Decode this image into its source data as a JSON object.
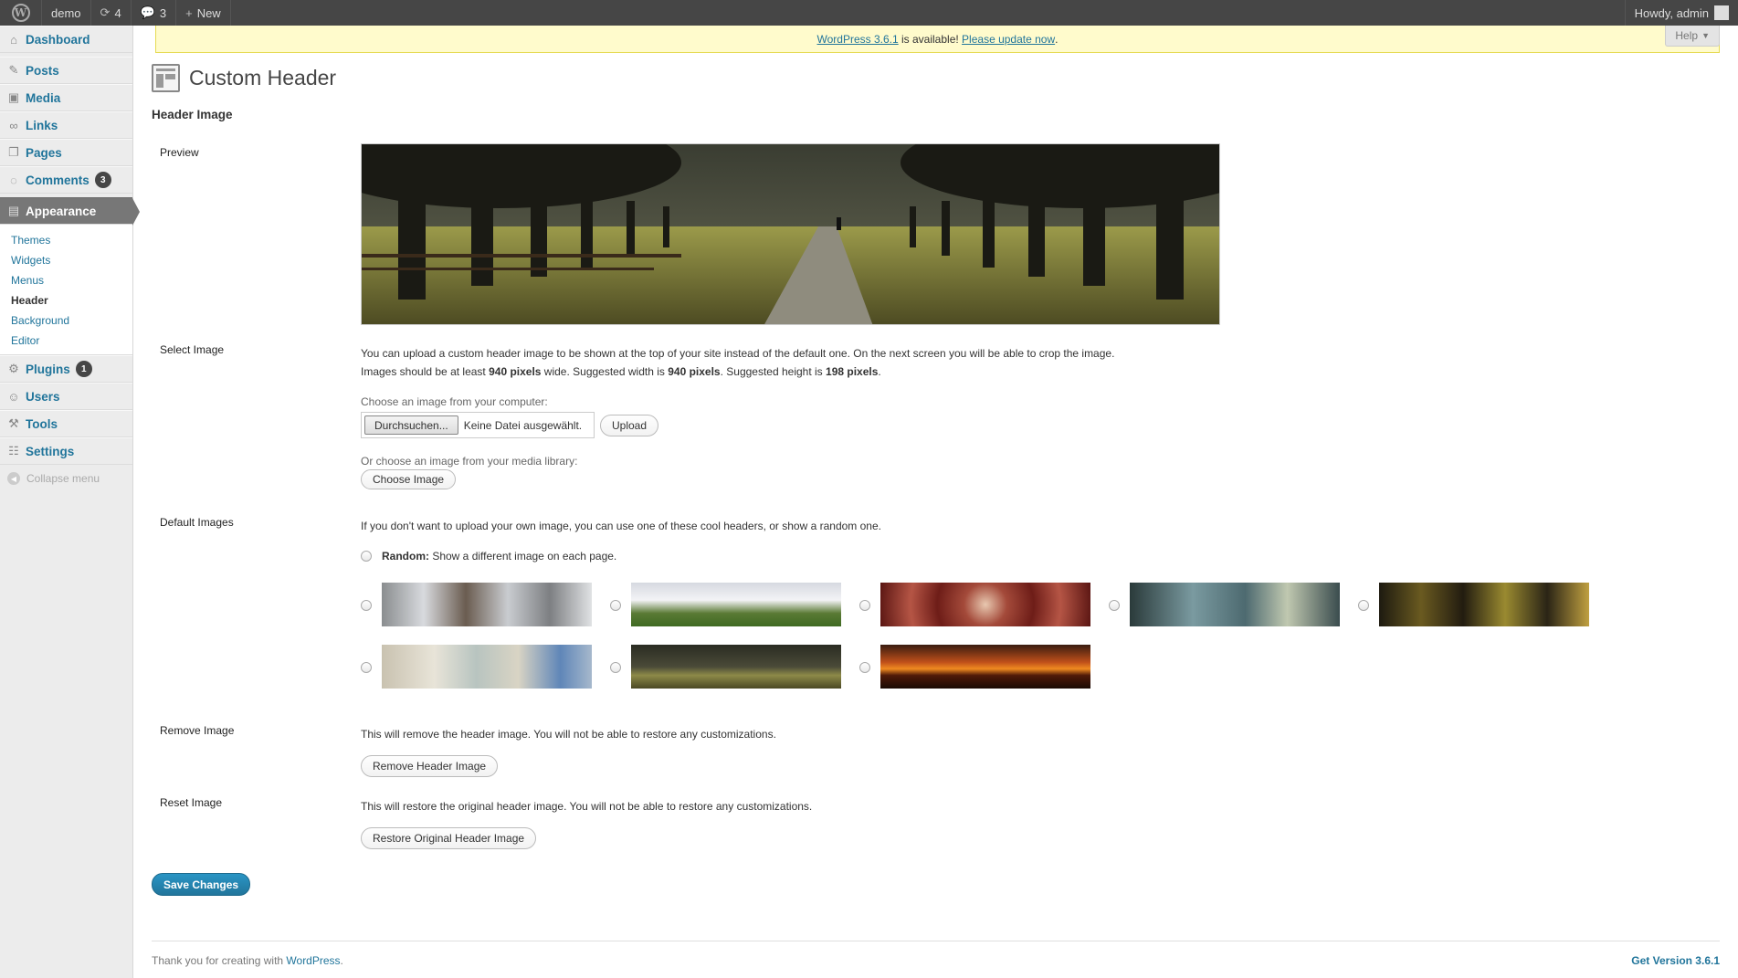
{
  "admin_bar": {
    "site_name": "demo",
    "updates_count": "4",
    "comments_count": "3",
    "new_label": "New",
    "howdy": "Howdy, admin"
  },
  "sidebar": {
    "items": [
      {
        "label": "Dashboard",
        "icon": "dashboard-icon"
      },
      {
        "label": "Posts",
        "icon": "pin-icon"
      },
      {
        "label": "Media",
        "icon": "media-icon"
      },
      {
        "label": "Links",
        "icon": "link-icon"
      },
      {
        "label": "Pages",
        "icon": "pages-icon"
      },
      {
        "label": "Comments",
        "icon": "comment-icon",
        "badge": "3"
      },
      {
        "label": "Appearance",
        "icon": "appearance-icon"
      },
      {
        "label": "Plugins",
        "icon": "plugin-icon",
        "badge": "1"
      },
      {
        "label": "Users",
        "icon": "users-icon"
      },
      {
        "label": "Tools",
        "icon": "tools-icon"
      },
      {
        "label": "Settings",
        "icon": "settings-icon"
      }
    ],
    "appearance_sub": [
      "Themes",
      "Widgets",
      "Menus",
      "Header",
      "Background",
      "Editor"
    ],
    "collapse_label": "Collapse menu"
  },
  "nag": {
    "version_link": "WordPress 3.6.1",
    "middle": " is available! ",
    "update_link": "Please update now",
    "end": "."
  },
  "help_label": "Help",
  "page": {
    "title": "Custom Header",
    "section_heading": "Header Image",
    "labels": {
      "preview": "Preview",
      "select": "Select Image",
      "defaults": "Default Images",
      "remove": "Remove Image",
      "reset": "Reset Image"
    },
    "select": {
      "line1": "You can upload a custom header image to be shown at the top of your site instead of the default one. On the next screen you will be able to crop the image.",
      "line2_a": "Images should be at least ",
      "line2_b": "940 pixels",
      "line2_c": " wide. Suggested width is ",
      "line2_d": "940 pixels",
      "line2_e": ". Suggested height is ",
      "line2_f": "198 pixels",
      "line2_g": ".",
      "choose_computer": "Choose an image from your computer:",
      "browse_label": "Durchsuchen...",
      "file_status": "Keine Datei ausgewählt.",
      "upload_label": "Upload",
      "choose_library": "Or choose an image from your media library:",
      "choose_image_label": "Choose Image"
    },
    "defaults": {
      "intro": "If you don't want to upload your own image, you can use one of these cool headers, or show a random one.",
      "random_bold": "Random:",
      "random_text": " Show a different image on each page."
    },
    "remove": {
      "text": "This will remove the header image. You will not be able to restore any customizations.",
      "button": "Remove Header Image"
    },
    "reset": {
      "text": "This will restore the original header image. You will not be able to restore any customizations.",
      "button": "Restore Original Header Image"
    },
    "save_label": "Save Changes"
  },
  "footer": {
    "thanks": "Thank you for creating with ",
    "wp_link": "WordPress",
    "dot": ".",
    "version": "Get Version 3.6.1"
  },
  "colors": {
    "admin_bar": "#464646",
    "link": "#21759b",
    "nag_bg": "#fffbcc",
    "primary_button": "#21759b"
  }
}
